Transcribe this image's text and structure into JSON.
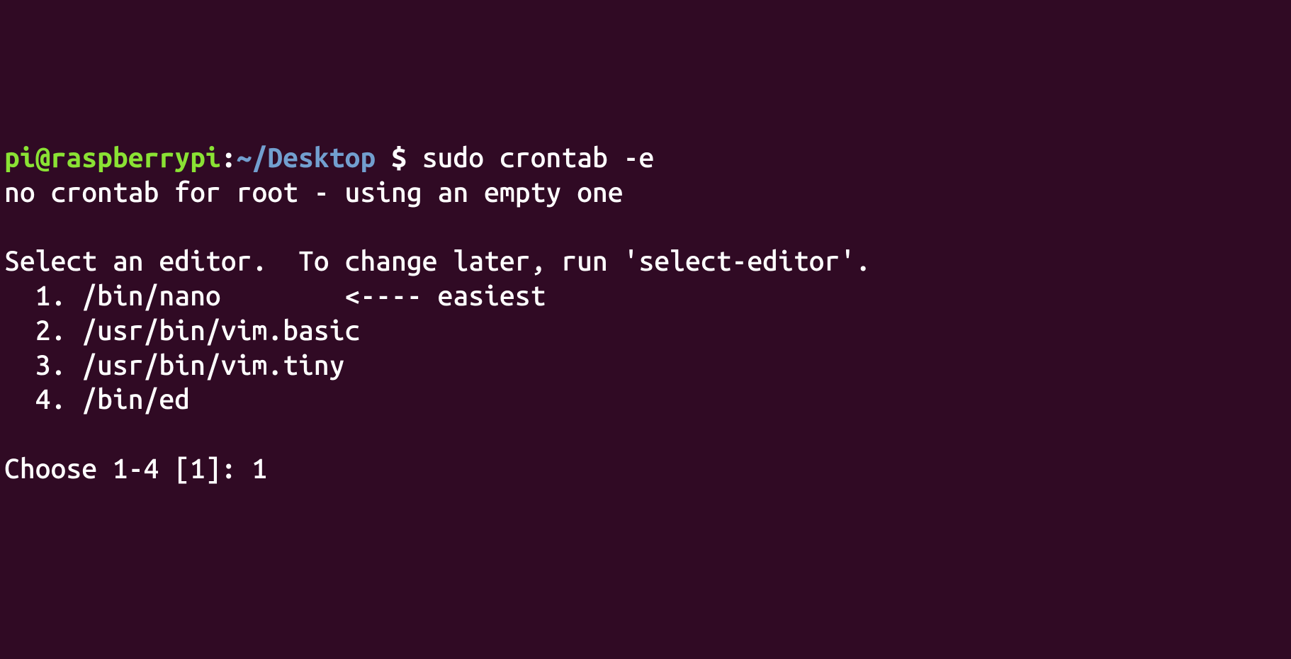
{
  "prompt": {
    "user_host": "pi@raspberrypi",
    "colon": ":",
    "path": "~/Desktop",
    "separator": " $ ",
    "command": "sudo crontab -e"
  },
  "output": {
    "line1": "no crontab for root - using an empty one",
    "blank1": "",
    "line2": "Select an editor.  To change later, run 'select-editor'.",
    "options": [
      "  1. /bin/nano        <---- easiest",
      "  2. /usr/bin/vim.basic",
      "  3. /usr/bin/vim.tiny",
      "  4. /bin/ed"
    ],
    "blank2": "",
    "choose_prompt": "Choose 1-4 [1]: ",
    "user_choice": "1"
  }
}
